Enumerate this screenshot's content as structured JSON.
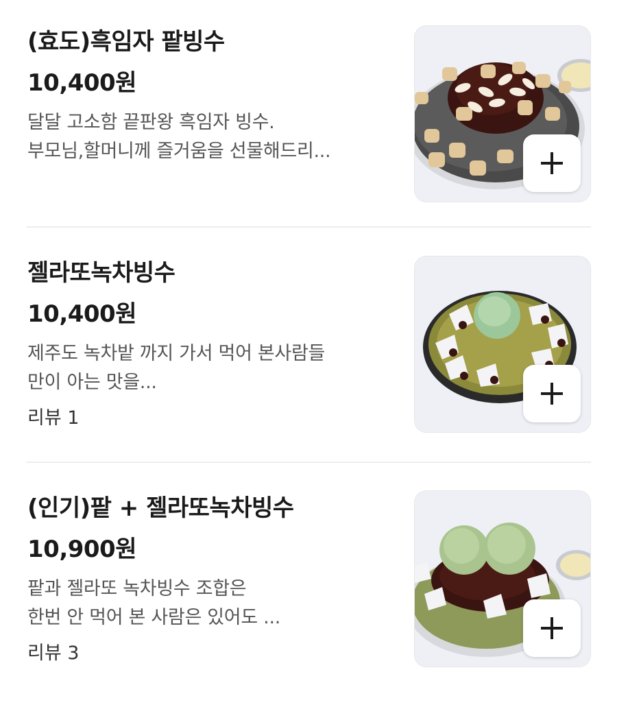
{
  "menu": {
    "items": [
      {
        "name": "(효도)흑임자 팥빙수",
        "price": "10,400원",
        "description": [
          "달달 고소함 끝판왕 흑임자 빙수.",
          "부모님,할머니께 즐거움을 선물해드리..."
        ],
        "review": "",
        "image_icon": "black-sesame-bingsu-image",
        "add_icon": "plus-icon"
      },
      {
        "name": "젤라또녹차빙수",
        "price": "10,400원",
        "description": [
          "제주도 녹차밭 까지 가서 먹어 본사람들",
          "만이 아는 맛을..."
        ],
        "review": "리뷰 1",
        "image_icon": "green-tea-gelato-bingsu-image",
        "add_icon": "plus-icon"
      },
      {
        "name": "(인기)팥 + 젤라또녹차빙수",
        "price": "10,900원",
        "description": [
          "팥과 젤라또 녹차빙수 조합은",
          "한번 안 먹어 본 사람은 있어도 ..."
        ],
        "review": "리뷰 3",
        "image_icon": "redbean-green-tea-bingsu-image",
        "add_icon": "plus-icon"
      }
    ]
  },
  "colors": {
    "text_primary": "#1a1a1a",
    "text_secondary": "#555555",
    "divider": "#ededed",
    "thumb_background": "#f2f3f7"
  }
}
